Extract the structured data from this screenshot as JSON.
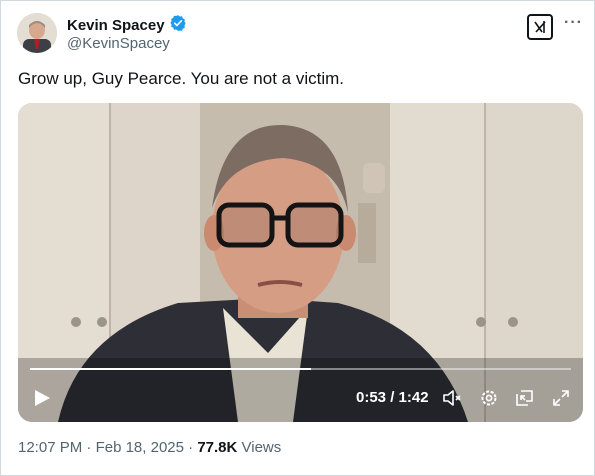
{
  "author": {
    "name": "Kevin Spacey",
    "handle": "@KevinSpacey",
    "verified_color": "#1d9bf0"
  },
  "post": {
    "text": "Grow up, Guy Pearce. You are not a victim."
  },
  "video": {
    "current_time": "0:53",
    "separator": "/",
    "duration": "1:42",
    "progress_fraction": 0.52
  },
  "meta": {
    "time": "12:07 PM",
    "dot1": "·",
    "date": "Feb 18, 2025",
    "dot2": "·",
    "views_count": "77.8K",
    "views_label": "Views"
  },
  "icons": [
    "verified-icon",
    "grok-icon",
    "more-icon",
    "play-icon",
    "mute-icon",
    "settings-icon",
    "pip-icon",
    "fullscreen-icon"
  ]
}
